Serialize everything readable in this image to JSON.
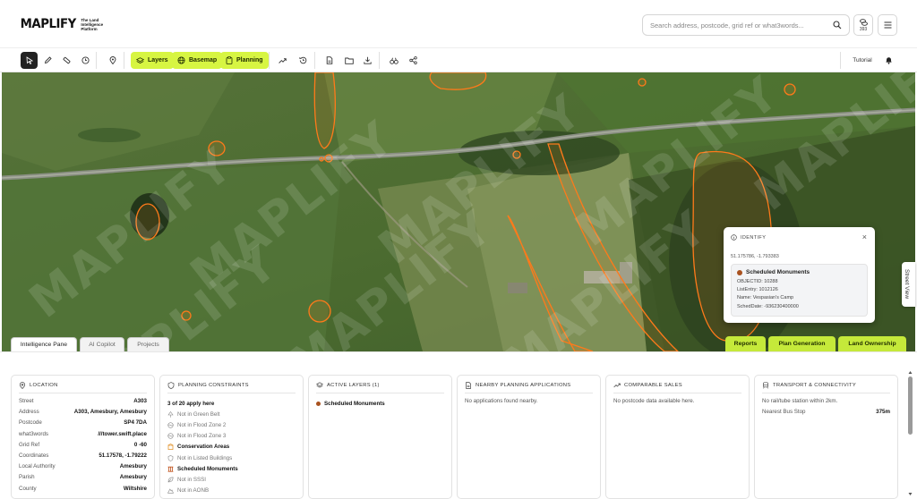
{
  "header": {
    "brand": "MAPLIFY",
    "brand_tag": "The Land Intelligence Platform",
    "search_placeholder": "Search address, postcode, grid ref or what3words...",
    "credits_count": "393"
  },
  "toolbar": {
    "layers_label": "Layers",
    "basemap_label": "Basemap",
    "planning_label": "Planning",
    "tutorial_label": "Tutorial"
  },
  "map": {
    "watermark": "MAPLIFY",
    "street_view_label": "Street View",
    "tabs": [
      "Intelligence Pane",
      "AI Copilot",
      "Projects"
    ],
    "action_tabs": [
      "Reports",
      "Plan Generation",
      "Land Ownership"
    ],
    "identify": {
      "title": "IDENTIFY",
      "coords": "51.175786, -1.793383",
      "layer": "Scheduled Monuments",
      "lines": [
        "OBJECTID: 10288",
        "ListEntry: 1012126",
        "Name: Vespasian's Camp",
        "SchedDate: -936230400000"
      ]
    },
    "colors": {
      "accent_lime": "#d7f542",
      "overlay_orange": "#ff7a1a",
      "monument_dot": "#a9521f"
    }
  },
  "panels": {
    "location": {
      "title": "LOCATION",
      "rows": [
        {
          "k": "Street",
          "v": "A303"
        },
        {
          "k": "Address",
          "v": "A303, Amesbury, Amesbury"
        },
        {
          "k": "Postcode",
          "v": "SP4 7DA"
        },
        {
          "k": "what3words",
          "v": "///tower.swift.place"
        },
        {
          "k": "Grid Ref",
          "v": "0 -60"
        },
        {
          "k": "Coordinates",
          "v": "51.17578, -1.79222"
        },
        {
          "k": "Local Authority",
          "v": "Amesbury"
        },
        {
          "k": "Parish",
          "v": "Amesbury"
        },
        {
          "k": "County",
          "v": "Wiltshire"
        }
      ]
    },
    "planning": {
      "title": "PLANNING CONSTRAINTS",
      "summary": "3 of 20 apply here",
      "items": [
        {
          "label": "Not in Green Belt",
          "hit": false
        },
        {
          "label": "Not in Flood Zone 2",
          "hit": false
        },
        {
          "label": "Not in Flood Zone 3",
          "hit": false
        },
        {
          "label": "Conservation Areas",
          "hit": true
        },
        {
          "label": "Not in Listed Buildings",
          "hit": false
        },
        {
          "label": "Scheduled Monuments",
          "hit": true
        },
        {
          "label": "Not in SSSI",
          "hit": false
        },
        {
          "label": "Not in AONB",
          "hit": false
        }
      ]
    },
    "active_layers": {
      "title": "ACTIVE LAYERS (1)",
      "items": [
        "Scheduled Monuments"
      ]
    },
    "nearby": {
      "title": "NEARBY PLANNING APPLICATIONS",
      "note": "No applications found nearby."
    },
    "sales": {
      "title": "COMPARABLE SALES",
      "note": "No postcode data available here."
    },
    "transport": {
      "title": "TRANSPORT & CONNECTIVITY",
      "note": "No rail/tube station within 2km.",
      "bus_label": "Nearest Bus Stop",
      "bus_value": "375m"
    }
  }
}
